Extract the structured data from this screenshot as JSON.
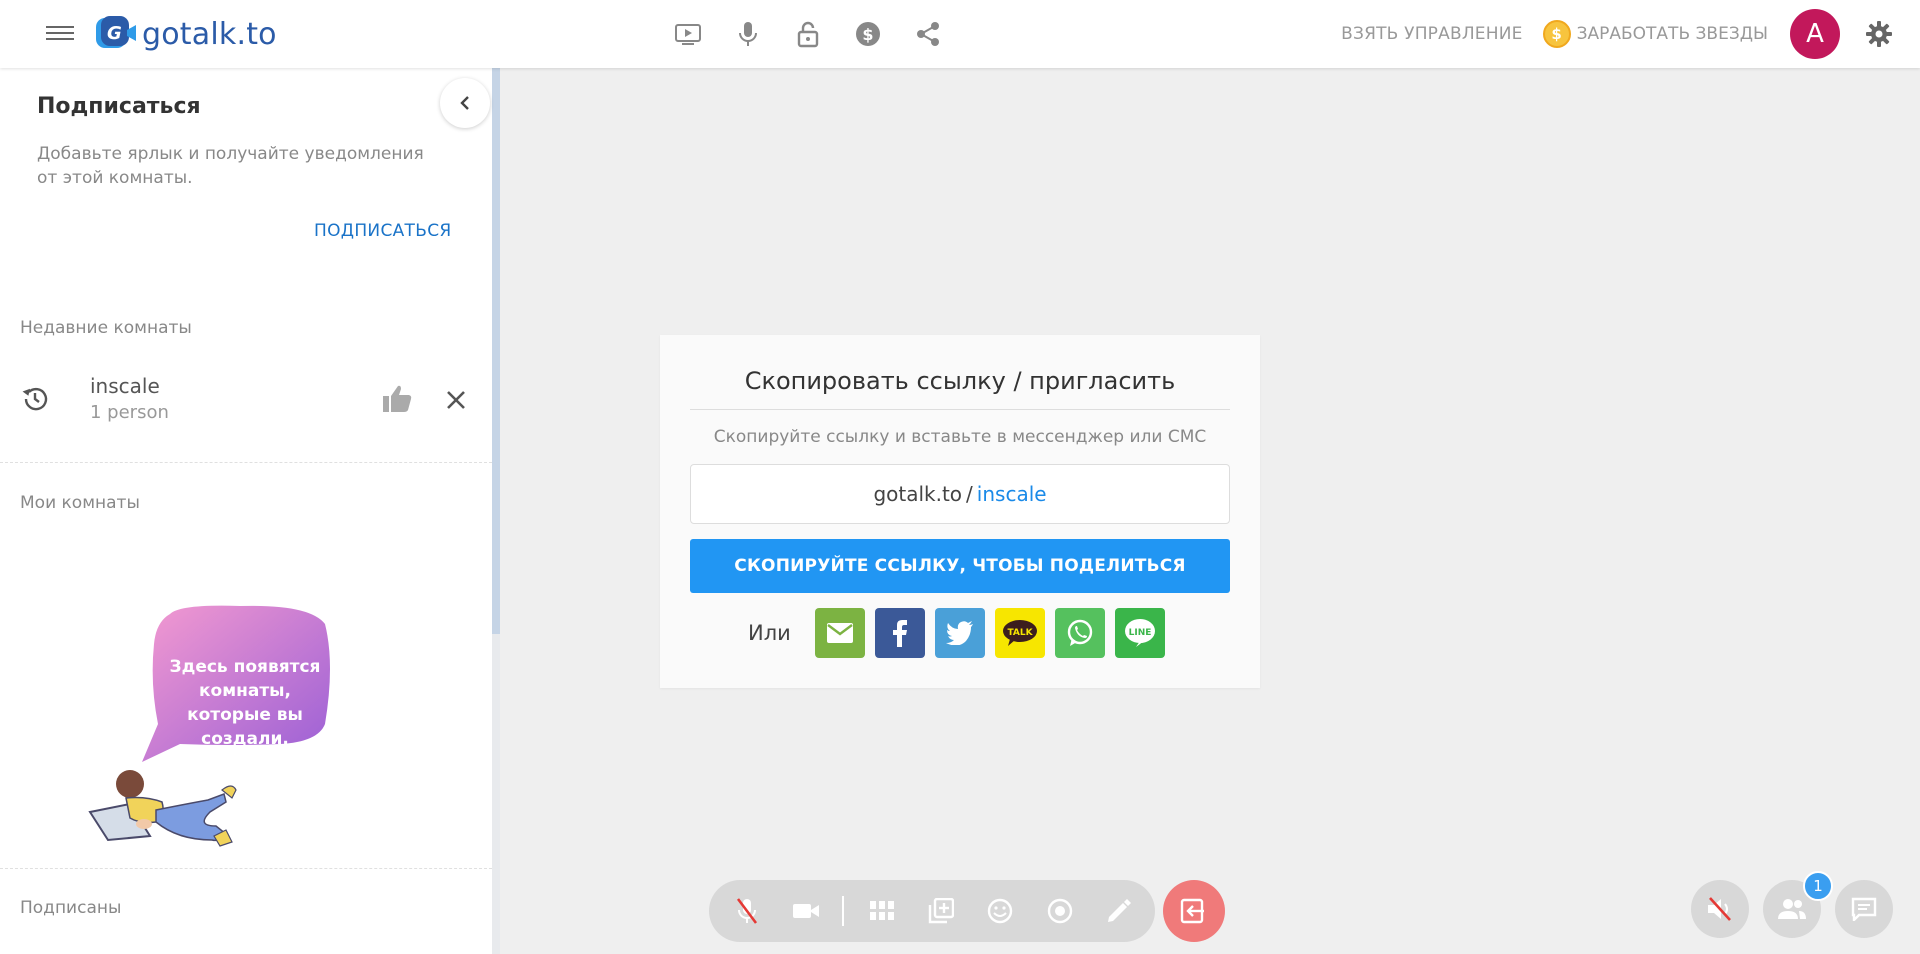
{
  "header": {
    "logo_text": "gotalk.to",
    "take_control": "ВЗЯТЬ УПРАВЛЕНИЕ",
    "earn_stars": "ЗАРАБОТАТЬ ЗВЕЗДЫ",
    "avatar_letter": "A",
    "icons": [
      "youtube-icon",
      "mic-icon",
      "unlock-icon",
      "dollar-icon",
      "share-icon"
    ]
  },
  "sidebar": {
    "subscribe_title": "Подписаться",
    "subscribe_desc": "Добавьте ярлык и получайте уведомления от этой комнаты.",
    "subscribe_link": "ПОДПИСАТЬСЯ",
    "recent_label": "Недавние комнаты",
    "recent_rooms": [
      {
        "name": "inscale",
        "count": "1 person"
      }
    ],
    "my_rooms_label": "Мои комнаты",
    "empty_bubble": "Здесь появятся комнаты, которые вы создали.",
    "subscribed_label": "Подписаны"
  },
  "invite": {
    "title": "Скопировать ссылку / пригласить",
    "subtitle": "Скопируйте ссылку и вставьте в мессенджер или СМС",
    "link_domain": "gotalk.to",
    "link_sep": "/",
    "link_room": "inscale",
    "copy_button": "СКОПИРУЙТЕ ССЫЛКУ, ЧТОБЫ ПОДЕЛИТЬСЯ",
    "or_label": "Или",
    "share_targets": [
      "email",
      "facebook",
      "twitter",
      "kakaotalk",
      "whatsapp",
      "line"
    ],
    "kakao_label": "TALK",
    "line_label": "LINE"
  },
  "controls": {
    "participants_count": "1"
  },
  "colors": {
    "primary": "#2196f3",
    "link": "#1a73c8",
    "avatar": "#c2185b",
    "exit": "#f07a7a",
    "email": "#7cb342",
    "facebook": "#3b5998",
    "twitter": "#4aa0d8",
    "kakao": "#f7e600",
    "whatsapp": "#55c15e",
    "line": "#3ab54a"
  }
}
